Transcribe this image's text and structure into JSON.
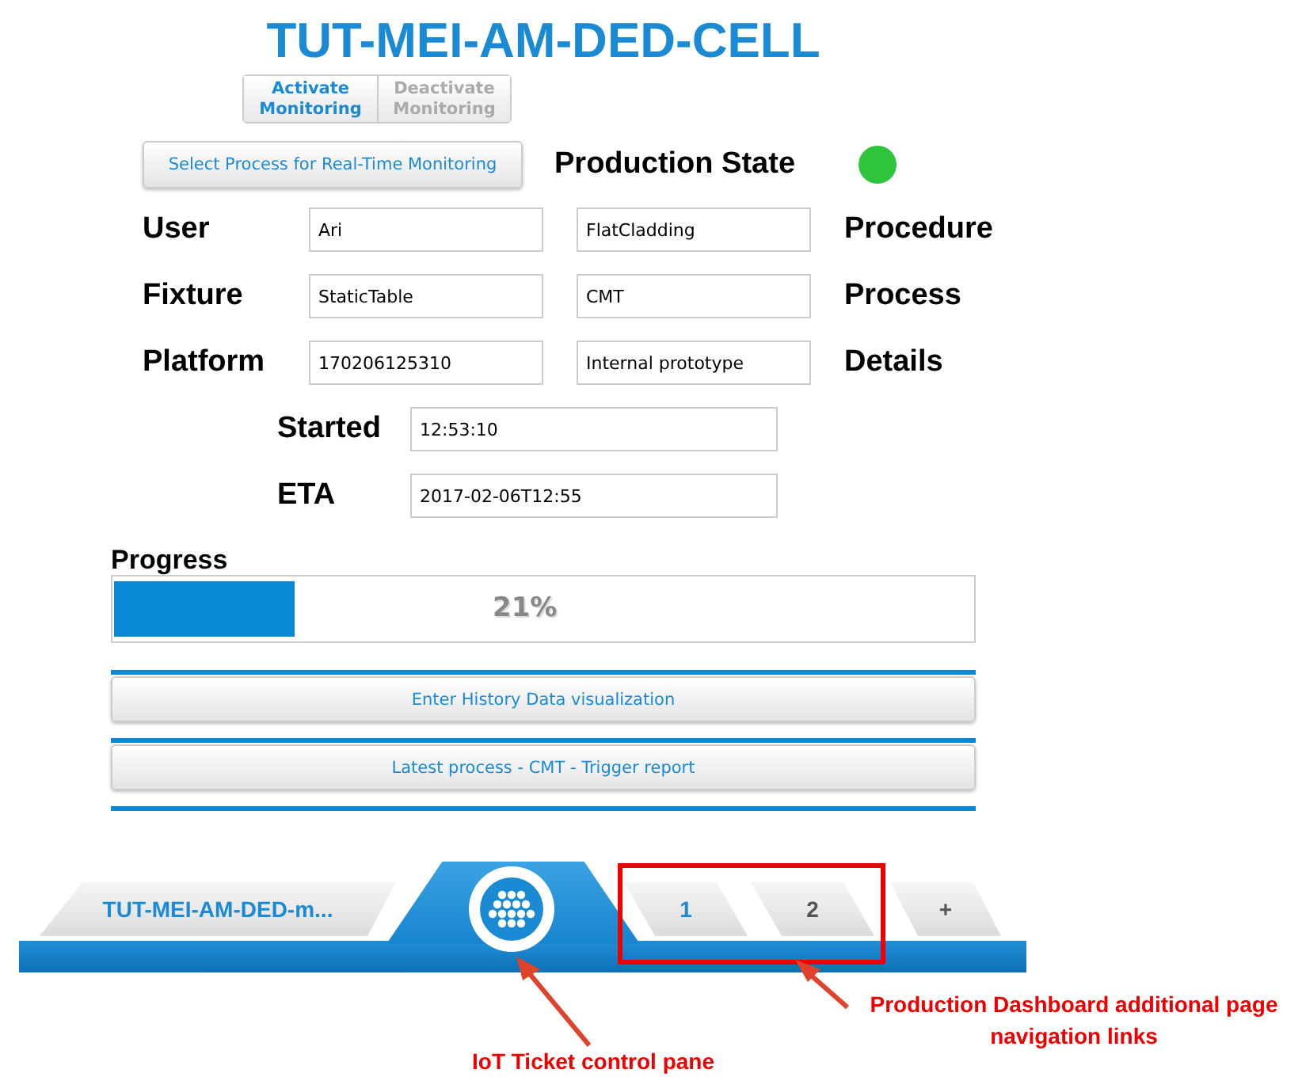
{
  "title": "TUT-MEI-AM-DED-CELL",
  "monitoring_toggle": [
    {
      "label": "Activate Monitoring",
      "selected": true
    },
    {
      "label": "Deactivate Monitoring",
      "selected": false
    }
  ],
  "select_process_button": "Select Process for Real-Time Monitoring",
  "production_state": {
    "label": "Production State",
    "color": "#2ec43c"
  },
  "fields": [
    {
      "label": "User",
      "value": "Ari",
      "value_2": "FlatCladding",
      "label_2": "Procedure"
    },
    {
      "label": "Fixture",
      "value": "StaticTable",
      "value_2": "CMT",
      "label_2": "Process"
    },
    {
      "label": "Platform",
      "value": "170206125310",
      "value_2": "Internal prototype",
      "label_2": "Details"
    }
  ],
  "time_fields": [
    {
      "label": "Started",
      "value": "12:53:10"
    },
    {
      "label": "ETA",
      "value": "2017-02-06T12:55"
    }
  ],
  "progress": {
    "label": "Progress",
    "level": 0.21,
    "reading": "21%"
  },
  "buttons": [
    "Enter History Data visualization",
    "Latest process - CMT - Trigger report"
  ],
  "bottom_bar": {
    "cell_tab": "TUT-MEI-AM-DED-m...",
    "page_tabs": [
      {
        "label": "1",
        "selected": true
      },
      {
        "label": "2",
        "selected": false
      },
      {
        "label": "+",
        "selected": false
      }
    ]
  },
  "annotations": [
    "IoT Ticket control pane",
    "Production Dashboard additional page navigation links"
  ]
}
